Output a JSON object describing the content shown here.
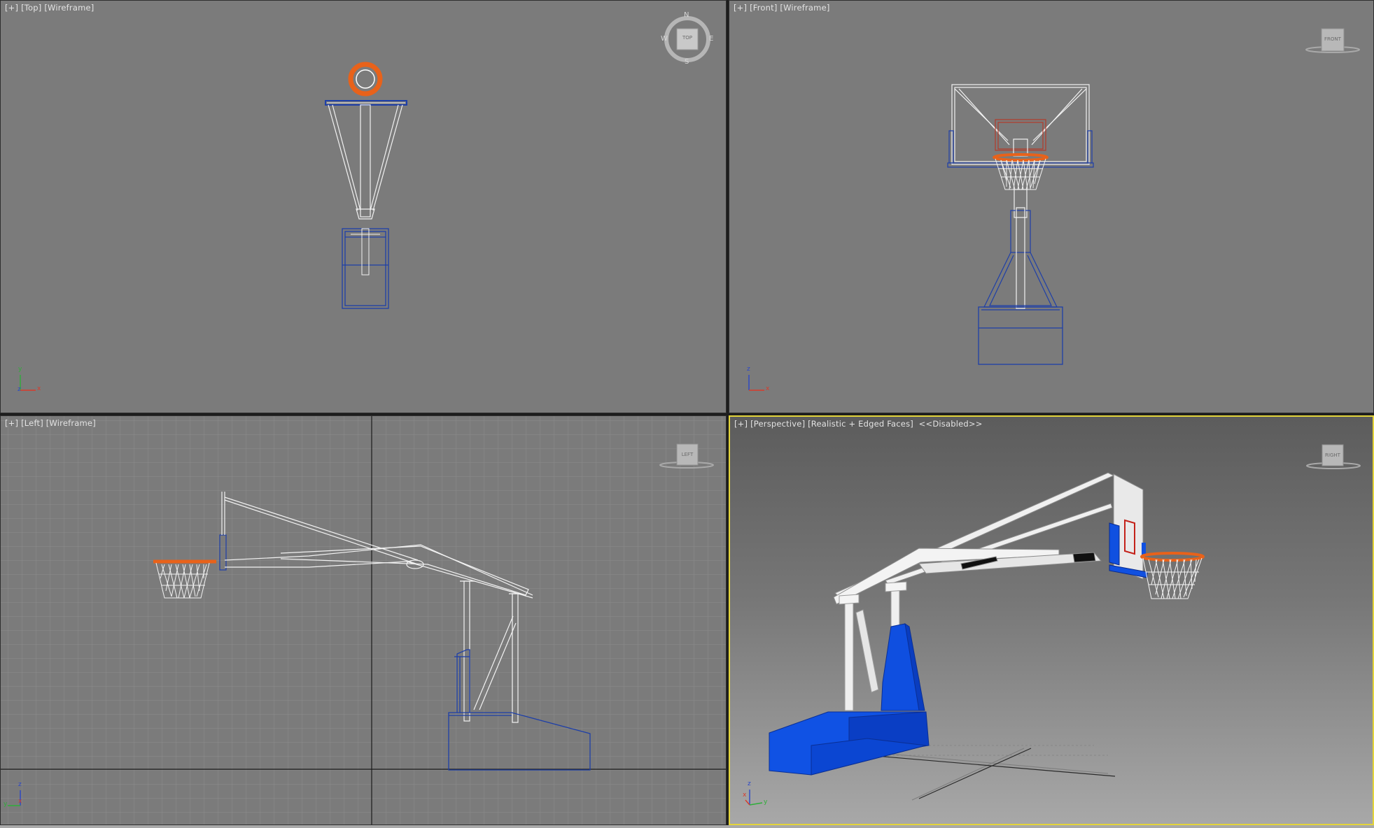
{
  "viewports": {
    "top": {
      "menu": "[+]",
      "view": "[Top]",
      "shading": "[Wireframe]",
      "viewcube": {
        "face": "TOP",
        "north": "N",
        "south": "S",
        "east": "E",
        "west": "W"
      },
      "axes": {
        "a": "y",
        "b": "x",
        "c": "z"
      }
    },
    "front": {
      "menu": "[+]",
      "view": "[Front]",
      "shading": "[Wireframe]",
      "viewcube": {
        "face": "FRONT"
      },
      "axes": {
        "a": "z",
        "b": "x"
      }
    },
    "left": {
      "menu": "[+]",
      "view": "[Left]",
      "shading": "[Wireframe]",
      "viewcube": {
        "face": "LEFT"
      },
      "axes": {
        "a": "z",
        "b": "x",
        "c": "y"
      }
    },
    "perspective": {
      "menu": "[+]",
      "view": "[Perspective]",
      "shading": "[Realistic + Edged Faces]",
      "extra": "<<Disabled>>",
      "viewcube": {
        "face": "RIGHT"
      },
      "axes": {
        "a": "z",
        "b": "y",
        "c": "x"
      }
    }
  },
  "colors": {
    "viewport_bg": "#7b7b7b",
    "active_border": "#e3d43a",
    "wire_white": "#f2f2f2",
    "wire_blue": "#1e3fa8",
    "rim_orange": "#e8621a",
    "body_blue": "#0a4fd8"
  }
}
